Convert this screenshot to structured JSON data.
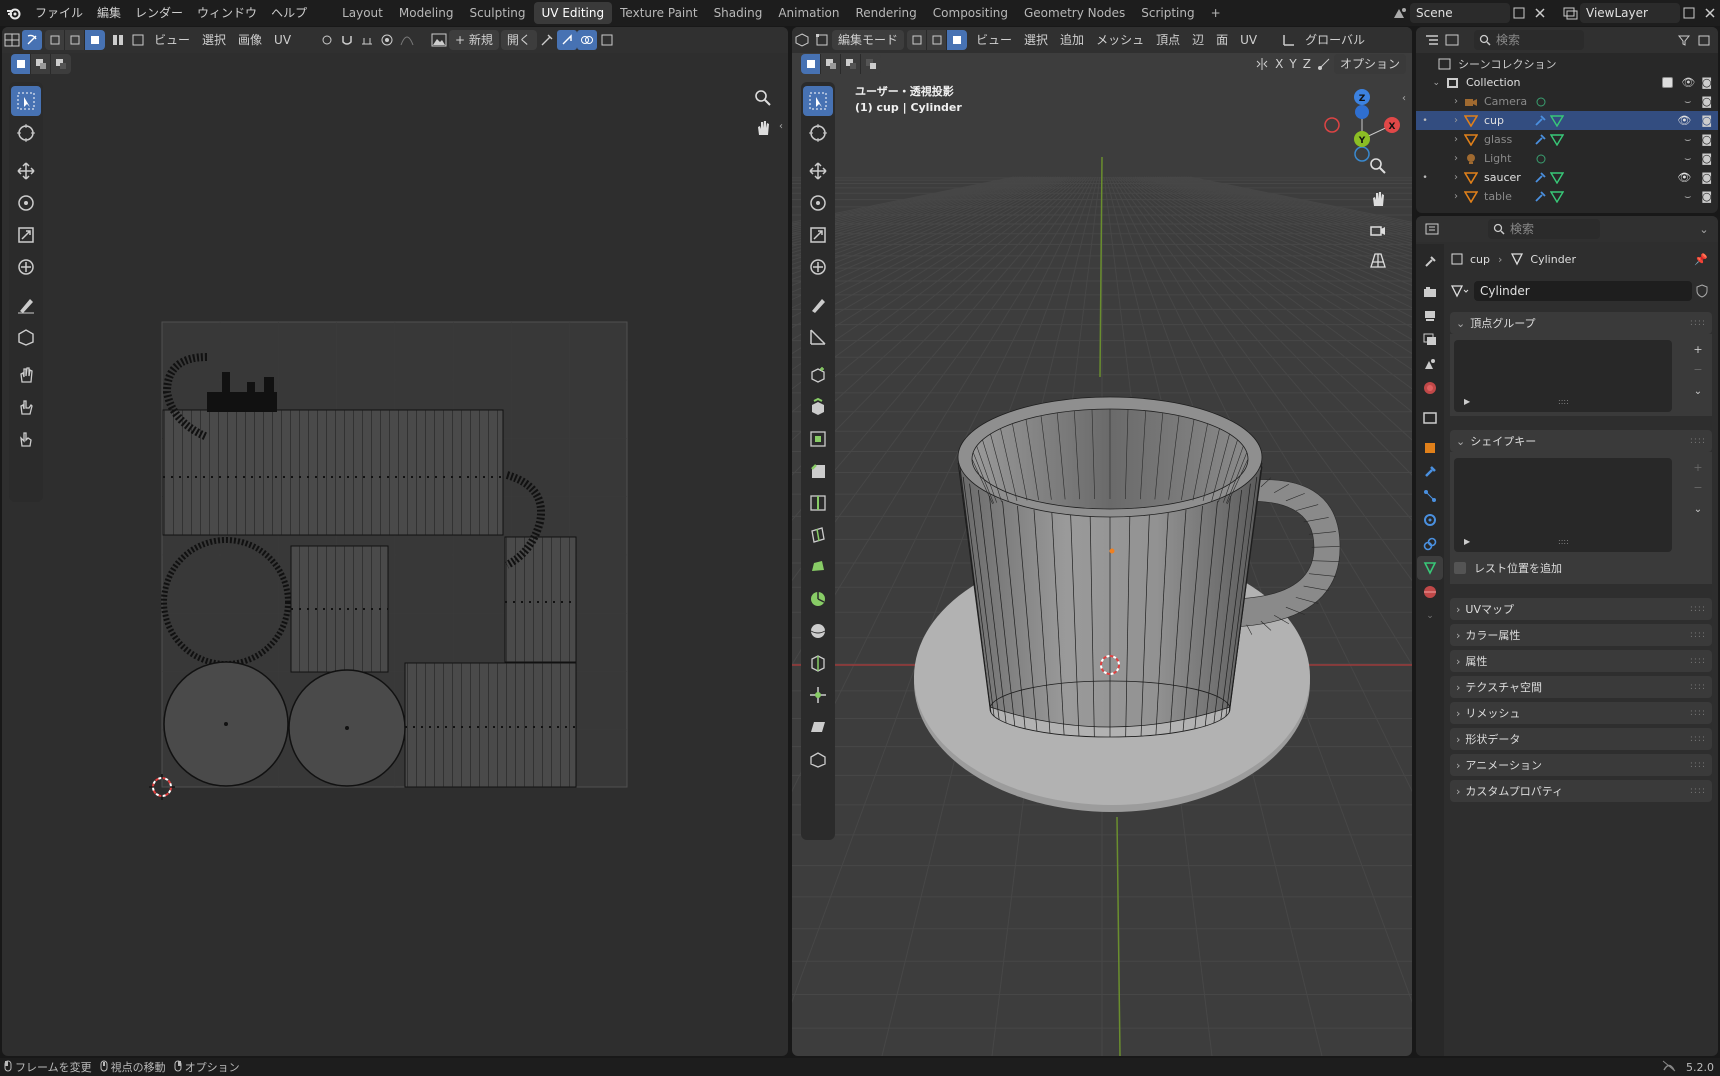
{
  "app": {
    "menu": [
      "ファイル",
      "編集",
      "レンダー",
      "ウィンドウ",
      "ヘルプ"
    ],
    "workspaces": [
      "Layout",
      "Modeling",
      "Sculpting",
      "UV Editing",
      "Texture Paint",
      "Shading",
      "Animation",
      "Rendering",
      "Compositing",
      "Geometry Nodes",
      "Scripting"
    ],
    "active_workspace": "UV Editing",
    "add_tab": "+",
    "scene": "Scene",
    "view_layer": "ViewLayer",
    "accent": "#4772b3"
  },
  "uv": {
    "menus": [
      "ビュー",
      "選択",
      "画像",
      "UV"
    ],
    "new_label": "+ 新規",
    "open_label": "開く"
  },
  "viewport": {
    "mode": "編集モード",
    "menus": [
      "ビュー",
      "選択",
      "追加",
      "メッシュ",
      "頂点",
      "辺",
      "面",
      "UV"
    ],
    "transform": "グローバル",
    "axes": [
      "X",
      "Y",
      "Z"
    ],
    "options": "オプション",
    "view_name": "ユーザー・透視投影",
    "object_info": "(1) cup | Cylinder",
    "gizmo": {
      "x": "X",
      "y": "Y",
      "z": "Z"
    }
  },
  "outliner": {
    "search": "検索",
    "scene_collection": "シーンコレクション",
    "collection": "Collection",
    "items": [
      {
        "name": "Camera",
        "type": "camera",
        "visible": false,
        "selected": false
      },
      {
        "name": "cup",
        "type": "mesh",
        "visible": true,
        "selected": true
      },
      {
        "name": "glass",
        "type": "mesh",
        "visible": false,
        "selected": false
      },
      {
        "name": "Light",
        "type": "light",
        "visible": false,
        "selected": false
      },
      {
        "name": "saucer",
        "type": "mesh",
        "visible": true,
        "selected": false
      },
      {
        "name": "table",
        "type": "mesh",
        "visible": false,
        "selected": false
      }
    ]
  },
  "properties": {
    "search": "検索",
    "breadcrumb_object": "cup",
    "breadcrumb_data": "Cylinder",
    "mesh_name": "Cylinder",
    "vertex_groups": "頂点グループ",
    "shape_keys": "シェイプキー",
    "rest_position": "レスト位置を追加",
    "panels": [
      "UVマップ",
      "カラー属性",
      "属性",
      "テクスチャ空間",
      "リメッシュ",
      "形状データ",
      "アニメーション",
      "カスタムプロパティ"
    ]
  },
  "status": {
    "items": [
      "フレームを変更",
      "視点の移動",
      "オプション"
    ],
    "version": "5.2.0"
  }
}
